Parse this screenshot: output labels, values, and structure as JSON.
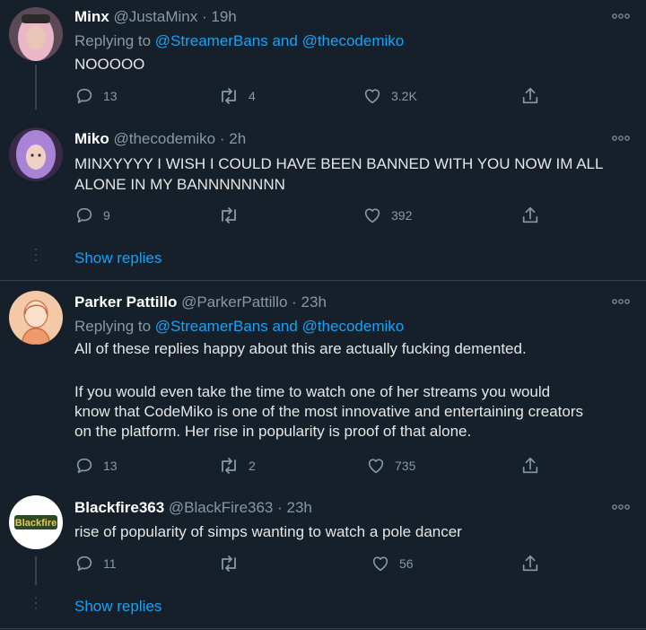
{
  "tweets": [
    {
      "name": "Minx",
      "handle": "@JustaMinx",
      "time": "· 19h",
      "replying_prefix": "Replying to",
      "replying_a": "@StreamerBans",
      "replying_and": "and",
      "replying_b": "@thecodemiko",
      "text": "NOOOOO",
      "replies": "13",
      "retweets": "4",
      "likes": "3.2K"
    },
    {
      "name": "Miko",
      "handle": "@thecodemiko",
      "time": "· 2h",
      "text_line1": "MINXYYYY I WISH I COULD HAVE BEEN BANNED WITH YOU NOW IM ALL",
      "text_line2": "ALONE IN MY BANNNNNNNN",
      "replies": "9",
      "retweets": "",
      "likes": "392"
    },
    {
      "name": "Parker Pattillo",
      "handle": "@ParkerPattillo",
      "time": "· 23h",
      "replying_prefix": "Replying to",
      "replying_a": "@StreamerBans",
      "replying_and": "and",
      "replying_b": "@thecodemiko",
      "para1": "All of these replies happy about this are actually fucking demented.",
      "para2_line1": "If you would even take the time to watch one of her streams you would",
      "para2_line2": "know that CodeMiko is one of the most innovative and entertaining creators",
      "para2_line3": "on the platform. Her rise in popularity is proof of that alone.",
      "replies": "13",
      "retweets": "2",
      "likes": "735"
    },
    {
      "name": "Blackfire363",
      "handle": "@BlackFire363",
      "time": "· 23h",
      "text": "rise of popularity of simps wanting to watch a pole dancer",
      "replies": "11",
      "retweets": "",
      "likes": "56",
      "avatar_text": "Blackfire"
    }
  ],
  "show_replies": "Show replies",
  "colors": {
    "background": "#15202b",
    "accent": "#1da1f2",
    "muted": "#8899a6",
    "border": "#38444d"
  }
}
